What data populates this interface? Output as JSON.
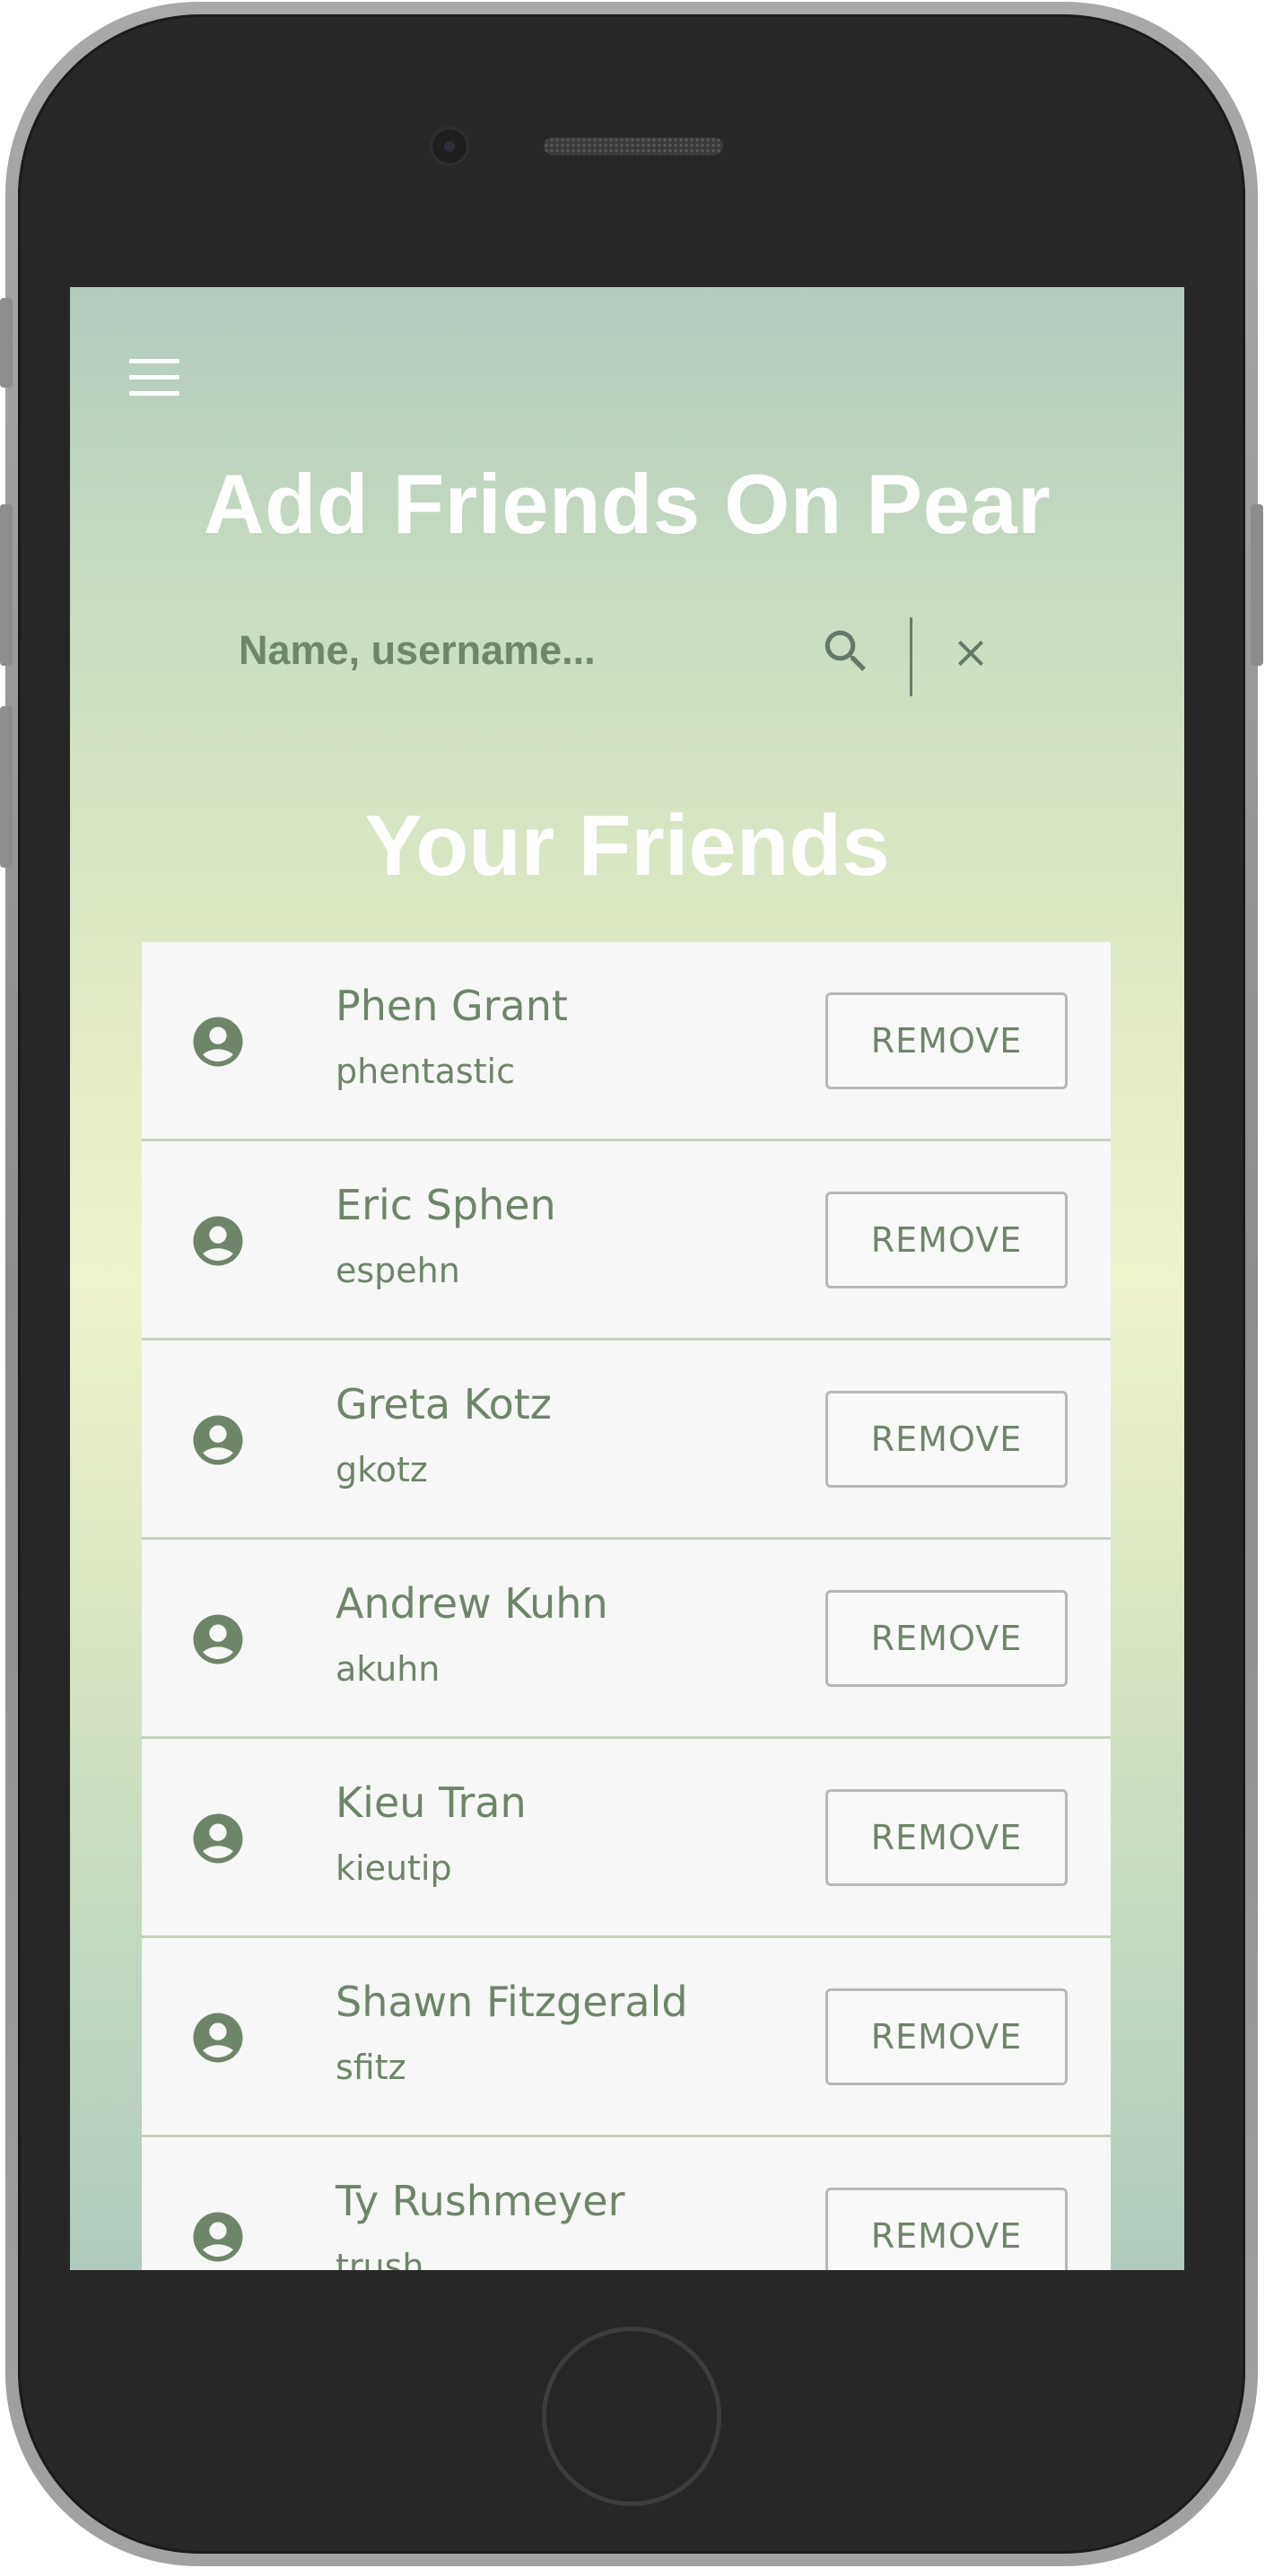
{
  "header": {
    "menu_icon": "hamburger-menu-icon",
    "title": "Add Friends On Pear"
  },
  "search": {
    "placeholder": "Name, username...",
    "value": "",
    "search_icon": "search-icon",
    "clear_icon": "close-icon"
  },
  "friends_section": {
    "title": "Your Friends",
    "remove_label": "REMOVE",
    "avatar_icon": "account-circle-icon",
    "friends": [
      {
        "name": "Phen Grant",
        "username": "phentastic"
      },
      {
        "name": "Eric Sphen",
        "username": "espehn"
      },
      {
        "name": "Greta Kotz",
        "username": "gkotz"
      },
      {
        "name": "Andrew Kuhn",
        "username": "akuhn"
      },
      {
        "name": "Kieu Tran",
        "username": "kieutip"
      },
      {
        "name": "Shawn Fitzgerald",
        "username": "sfitz"
      },
      {
        "name": "Ty Rushmeyer",
        "username": "trush"
      }
    ]
  },
  "colors": {
    "accent_green": "#6e8569",
    "gradient_top": "#b2cbbd",
    "gradient_middle": "#eef3cc",
    "card_background": "#f7f7f7"
  }
}
